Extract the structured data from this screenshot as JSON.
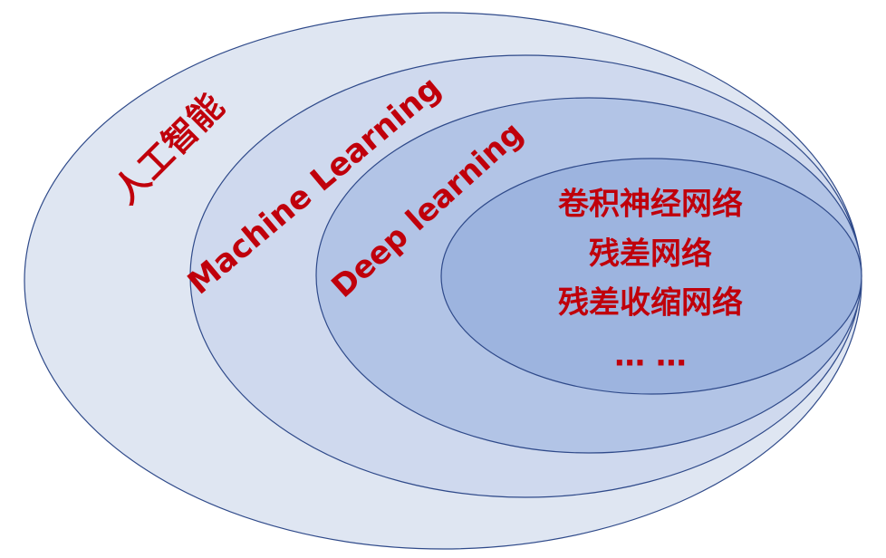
{
  "diagram": {
    "levels": [
      {
        "label": "人工智能",
        "fill": "#dfe6f2"
      },
      {
        "label": "Machine Learning",
        "fill": "#cfd9ee"
      },
      {
        "label": "Deep learning",
        "fill": "#b2c4e6"
      },
      {
        "label": "",
        "fill": "#9db4df"
      }
    ],
    "inner_items": [
      "卷积神经网络",
      "残差网络",
      "残差收缩网络",
      "… …"
    ],
    "colors": {
      "outline": "#2f4a8a",
      "label_text": "#c0000b",
      "background": "#ffffff"
    }
  }
}
